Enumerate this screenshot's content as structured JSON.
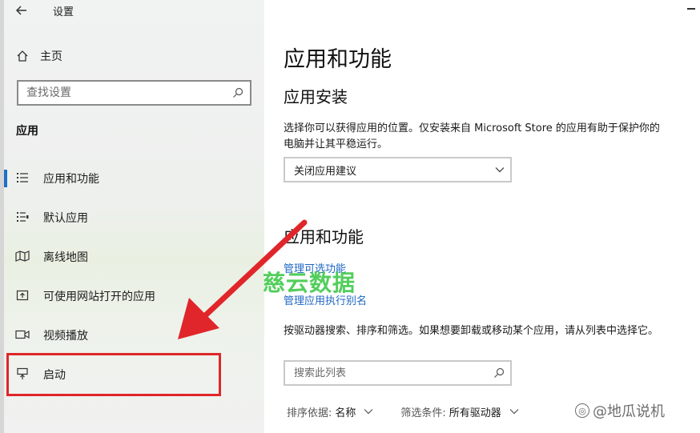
{
  "window": {
    "title": "设置"
  },
  "sidebar": {
    "home_label": "主页",
    "search_placeholder": "查找设置",
    "section_label": "应用",
    "items": [
      {
        "label": "应用和功能",
        "icon": "list-icon",
        "active": true
      },
      {
        "label": "默认应用",
        "icon": "default-apps-icon",
        "active": false
      },
      {
        "label": "离线地图",
        "icon": "map-icon",
        "active": false
      },
      {
        "label": "可使用网站打开的应用",
        "icon": "open-web-app-icon",
        "active": false
      },
      {
        "label": "视频播放",
        "icon": "video-icon",
        "active": false
      },
      {
        "label": "启动",
        "icon": "startup-icon",
        "active": false
      }
    ]
  },
  "content": {
    "page_title": "应用和功能",
    "install_heading": "应用安装",
    "install_desc": "选择你可以获得应用的位置。仅安装来自 Microsoft Store 的应用有助于保护你的电脑并让其平稳运行。",
    "install_dropdown_value": "关闭应用建议",
    "apps_heading": "应用和功能",
    "link_optional_features": "管理可选功能",
    "link_app_aliases": "管理应用执行别名",
    "apps_desc": "按驱动器搜索、排序和筛选。如果想要卸载或移动某个应用，请从列表中选择它。",
    "list_search_placeholder": "搜索此列表",
    "sort_label": "排序依据:",
    "sort_value": "名称",
    "filter_label": "筛选条件:",
    "filter_value": "所有驱动器"
  },
  "overlays": {
    "watermark_center": "慈云数据",
    "watermark_corner": "@地瓜说机",
    "arrow_color": "#e0262a",
    "highlight_color": "#e0262a"
  },
  "colors": {
    "accent": "#1f6fc6",
    "link": "#1d66c2",
    "watermark_green": "#40c94a"
  }
}
